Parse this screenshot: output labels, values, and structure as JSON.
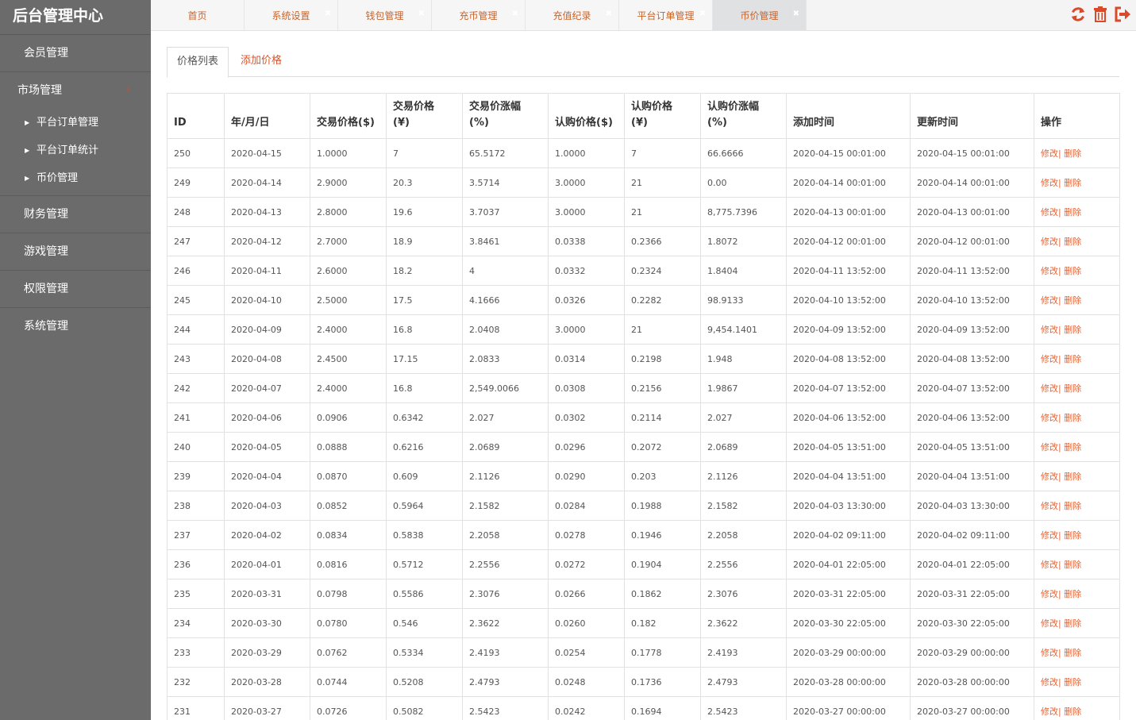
{
  "brand": "后台管理中心",
  "sidebar": {
    "items": [
      {
        "label": "会员管理"
      },
      {
        "label": "市场管理",
        "chevron": "›",
        "sub": [
          "平台订单管理",
          "平台订单统计",
          "币价管理"
        ]
      },
      {
        "label": "财务管理"
      },
      {
        "label": "游戏管理"
      },
      {
        "label": "权限管理"
      },
      {
        "label": "系统管理"
      }
    ]
  },
  "tabs": [
    {
      "label": "首页"
    },
    {
      "label": "系统设置"
    },
    {
      "label": "钱包管理"
    },
    {
      "label": "充币管理"
    },
    {
      "label": "充值纪录"
    },
    {
      "label": "平台订单管理"
    },
    {
      "label": "币价管理"
    }
  ],
  "icons": {
    "refresh": "refresh-icon",
    "trash": "trash-icon",
    "logout": "logout-icon",
    "accent": "#d94a2a"
  },
  "subtabs": {
    "list": "价格列表",
    "add": "添加价格"
  },
  "table": {
    "headers": [
      "ID",
      "年/月/日",
      "交易价格($)",
      "交易价格\n(¥)",
      "交易价涨幅\n(%)",
      "认购价格($)",
      "认购价格\n(¥)",
      "认购价涨幅\n(%)",
      "添加时间",
      "更新时间",
      "操作"
    ],
    "op_edit": "修改|",
    "op_delete": " 删除",
    "rows": [
      [
        "250",
        "2020-04-15",
        "1.0000",
        "7",
        "65.5172",
        "1.0000",
        "7",
        "66.6666",
        "2020-04-15 00:01:00",
        "2020-04-15 00:01:00"
      ],
      [
        "249",
        "2020-04-14",
        "2.9000",
        "20.3",
        "3.5714",
        "3.0000",
        "21",
        "0.00",
        "2020-04-14 00:01:00",
        "2020-04-14 00:01:00"
      ],
      [
        "248",
        "2020-04-13",
        "2.8000",
        "19.6",
        "3.7037",
        "3.0000",
        "21",
        "8,775.7396",
        "2020-04-13 00:01:00",
        "2020-04-13 00:01:00"
      ],
      [
        "247",
        "2020-04-12",
        "2.7000",
        "18.9",
        "3.8461",
        "0.0338",
        "0.2366",
        "1.8072",
        "2020-04-12 00:01:00",
        "2020-04-12 00:01:00"
      ],
      [
        "246",
        "2020-04-11",
        "2.6000",
        "18.2",
        "4",
        "0.0332",
        "0.2324",
        "1.8404",
        "2020-04-11 13:52:00",
        "2020-04-11 13:52:00"
      ],
      [
        "245",
        "2020-04-10",
        "2.5000",
        "17.5",
        "4.1666",
        "0.0326",
        "0.2282",
        "98.9133",
        "2020-04-10 13:52:00",
        "2020-04-10 13:52:00"
      ],
      [
        "244",
        "2020-04-09",
        "2.4000",
        "16.8",
        "2.0408",
        "3.0000",
        "21",
        "9,454.1401",
        "2020-04-09 13:52:00",
        "2020-04-09 13:52:00"
      ],
      [
        "243",
        "2020-04-08",
        "2.4500",
        "17.15",
        "2.0833",
        "0.0314",
        "0.2198",
        "1.948",
        "2020-04-08 13:52:00",
        "2020-04-08 13:52:00"
      ],
      [
        "242",
        "2020-04-07",
        "2.4000",
        "16.8",
        "2,549.0066",
        "0.0308",
        "0.2156",
        "1.9867",
        "2020-04-07 13:52:00",
        "2020-04-07 13:52:00"
      ],
      [
        "241",
        "2020-04-06",
        "0.0906",
        "0.6342",
        "2.027",
        "0.0302",
        "0.2114",
        "2.027",
        "2020-04-06 13:52:00",
        "2020-04-06 13:52:00"
      ],
      [
        "240",
        "2020-04-05",
        "0.0888",
        "0.6216",
        "2.0689",
        "0.0296",
        "0.2072",
        "2.0689",
        "2020-04-05 13:51:00",
        "2020-04-05 13:51:00"
      ],
      [
        "239",
        "2020-04-04",
        "0.0870",
        "0.609",
        "2.1126",
        "0.0290",
        "0.203",
        "2.1126",
        "2020-04-04 13:51:00",
        "2020-04-04 13:51:00"
      ],
      [
        "238",
        "2020-04-03",
        "0.0852",
        "0.5964",
        "2.1582",
        "0.0284",
        "0.1988",
        "2.1582",
        "2020-04-03 13:30:00",
        "2020-04-03 13:30:00"
      ],
      [
        "237",
        "2020-04-02",
        "0.0834",
        "0.5838",
        "2.2058",
        "0.0278",
        "0.1946",
        "2.2058",
        "2020-04-02 09:11:00",
        "2020-04-02 09:11:00"
      ],
      [
        "236",
        "2020-04-01",
        "0.0816",
        "0.5712",
        "2.2556",
        "0.0272",
        "0.1904",
        "2.2556",
        "2020-04-01 22:05:00",
        "2020-04-01 22:05:00"
      ],
      [
        "235",
        "2020-03-31",
        "0.0798",
        "0.5586",
        "2.3076",
        "0.0266",
        "0.1862",
        "2.3076",
        "2020-03-31 22:05:00",
        "2020-03-31 22:05:00"
      ],
      [
        "234",
        "2020-03-30",
        "0.0780",
        "0.546",
        "2.3622",
        "0.0260",
        "0.182",
        "2.3622",
        "2020-03-30 22:05:00",
        "2020-03-30 22:05:00"
      ],
      [
        "233",
        "2020-03-29",
        "0.0762",
        "0.5334",
        "2.4193",
        "0.0254",
        "0.1778",
        "2.4193",
        "2020-03-29 00:00:00",
        "2020-03-29 00:00:00"
      ],
      [
        "232",
        "2020-03-28",
        "0.0744",
        "0.5208",
        "2.4793",
        "0.0248",
        "0.1736",
        "2.4793",
        "2020-03-28 00:00:00",
        "2020-03-28 00:00:00"
      ],
      [
        "231",
        "2020-03-27",
        "0.0726",
        "0.5082",
        "2.5423",
        "0.0242",
        "0.1694",
        "2.5423",
        "2020-03-27 00:00:00",
        "2020-03-27 00:00:00"
      ]
    ]
  }
}
